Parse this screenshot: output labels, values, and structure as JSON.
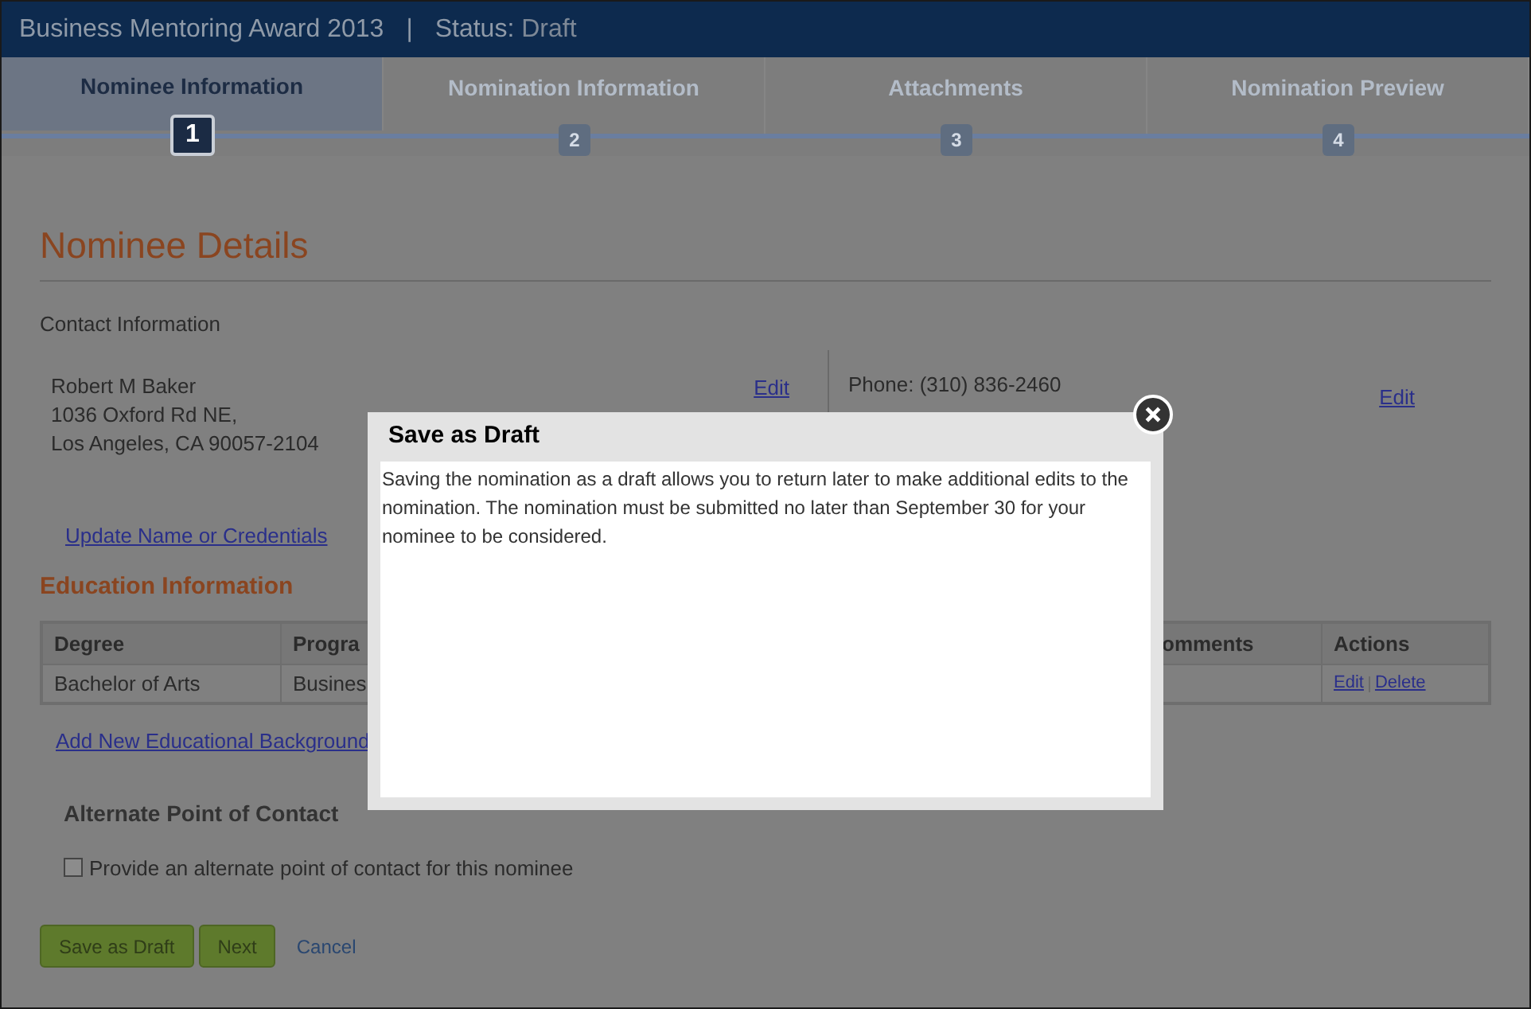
{
  "header": {
    "title": "Business Mentoring Award 2013",
    "separator": "|",
    "status_label": "Status:",
    "status_value": "Draft"
  },
  "steps": [
    {
      "label": "Nominee Information",
      "number": "1",
      "selected": true
    },
    {
      "label": "Nomination Information",
      "number": "2",
      "selected": false
    },
    {
      "label": "Attachments",
      "number": "3",
      "selected": false
    },
    {
      "label": "Nomination Preview",
      "number": "4",
      "selected": false
    }
  ],
  "page_title": "Nominee Details",
  "contact": {
    "heading": "Contact Information",
    "address_lines": [
      "Robert M Baker",
      "1036 Oxford Rd NE,",
      "Los Angeles, CA 90057-2104"
    ],
    "address_edit": "Edit",
    "phone": "Phone: (310) 836-2460",
    "phone_edit": "Edit",
    "update_link": "Update Name or Credentials"
  },
  "education": {
    "heading": "Education Information",
    "column_1": "Degree",
    "column_2": "Progra",
    "column_3": "omments",
    "column_4": "Actions",
    "rows": [
      {
        "column_1": "Bachelor of Arts",
        "column_2": "Busines",
        "actions": [
          {
            "label": "Edit"
          },
          {
            "label": "Delete"
          }
        ]
      }
    ],
    "add_link": "Add New Educational Background"
  },
  "alternate_contact": {
    "heading": "Alternate Point of Contact",
    "checkbox": {
      "label": "Provide an alternate point of contact for this nominee",
      "checked": false
    }
  },
  "buttons": [
    {
      "label": "Save as Draft",
      "kind": "primary"
    },
    {
      "label": "Next",
      "kind": "primary"
    },
    {
      "label": "Cancel",
      "kind": "link"
    }
  ],
  "dialog": {
    "title": "Save as Draft",
    "message": "Saving the nomination as a draft allows you to return later to make additional edits to the nomination. The nomination must be submitted no later than September 30 for your nominee to be considered."
  }
}
